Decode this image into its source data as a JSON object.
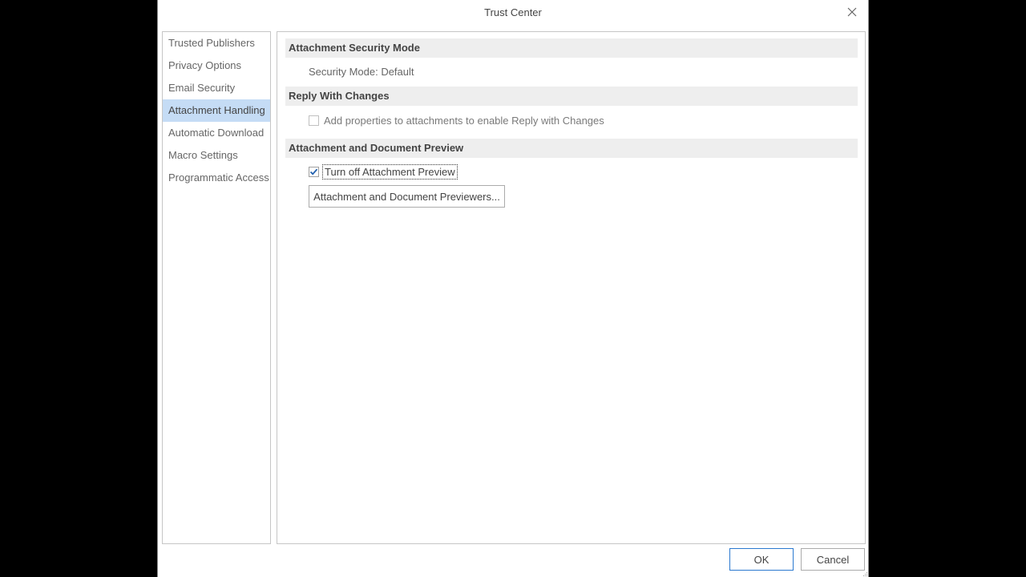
{
  "window": {
    "title": "Trust Center"
  },
  "nav": {
    "items": [
      {
        "label": "Trusted Publishers",
        "selected": false
      },
      {
        "label": "Privacy Options",
        "selected": false
      },
      {
        "label": "Email Security",
        "selected": false
      },
      {
        "label": "Attachment Handling",
        "selected": true
      },
      {
        "label": "Automatic Download",
        "selected": false
      },
      {
        "label": "Macro Settings",
        "selected": false
      },
      {
        "label": "Programmatic Access",
        "selected": false
      }
    ]
  },
  "sections": {
    "security_mode": {
      "header": "Attachment Security Mode",
      "text": "Security Mode: Default"
    },
    "reply_changes": {
      "header": "Reply With Changes",
      "checkbox_label": "Add properties to attachments to enable Reply with Changes",
      "checked": false,
      "enabled": false
    },
    "preview": {
      "header": "Attachment and Document Preview",
      "checkbox_label": "Turn off Attachment Preview",
      "checked": true,
      "button_label": "Attachment and Document Previewers..."
    }
  },
  "footer": {
    "ok_label": "OK",
    "cancel_label": "Cancel"
  },
  "colors": {
    "selection": "#c5dcf5",
    "section_header_bg": "#eeeeee",
    "ok_border": "#2b79d0",
    "check_mark": "#1f5fae"
  }
}
